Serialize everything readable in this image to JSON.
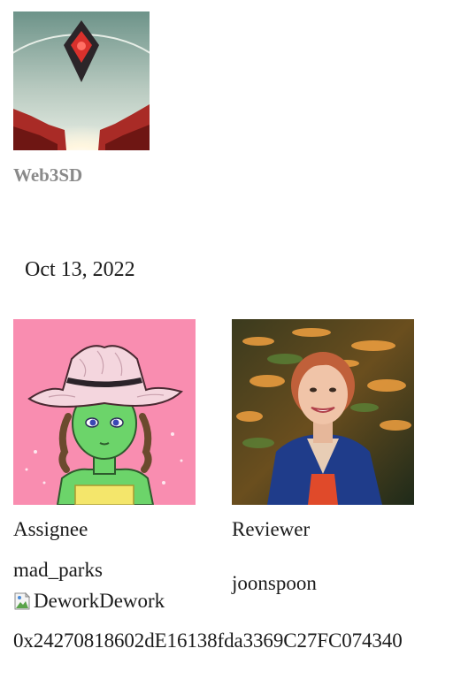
{
  "org": {
    "name": "Web3SD",
    "avatar_icon": "no-mans-sky-diamond-logo"
  },
  "task": {
    "date": "Oct 13, 2022"
  },
  "assignee": {
    "label": "Assignee",
    "username": "mad_parks",
    "avatar_icon": "green-cowgirl-nft-avatar",
    "badge_alt": "Dework",
    "badge_text": "Dework",
    "wallet": "0x24270818602dE16138fda3369C27FC074340"
  },
  "reviewer": {
    "label": "Reviewer",
    "username": "joonspoon",
    "avatar_icon": "woman-portrait-avatar"
  },
  "colors": {
    "org_name": "#8a8a8a",
    "assignee_bg": "#f98db0",
    "text": "#1a1a1a"
  }
}
